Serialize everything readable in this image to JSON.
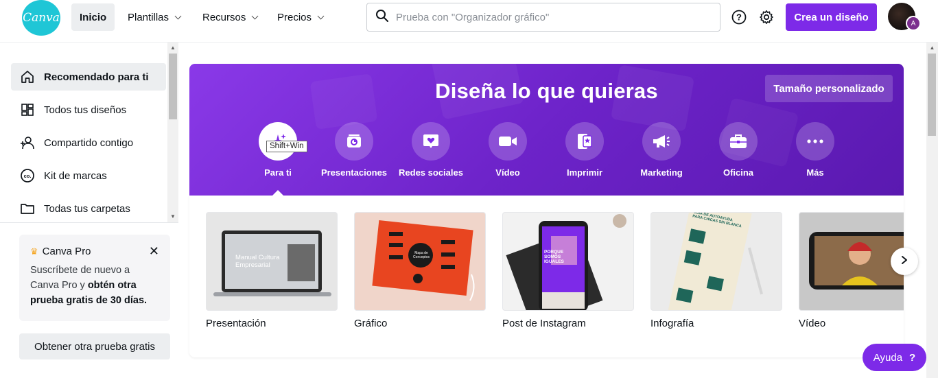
{
  "header": {
    "logo_text": "Canva",
    "nav": [
      {
        "label": "Inicio"
      },
      {
        "label": "Plantillas"
      },
      {
        "label": "Recursos"
      },
      {
        "label": "Precios"
      }
    ],
    "search_placeholder": "Prueba con \"Organizador gráfico\"",
    "create_label": "Crea un diseño",
    "avatar_initial": "A"
  },
  "sidebar": {
    "items": [
      {
        "label": "Recomendado para ti",
        "icon": "home-icon"
      },
      {
        "label": "Todos tus diseños",
        "icon": "grid-icon"
      },
      {
        "label": "Compartido contigo",
        "icon": "users-icon"
      },
      {
        "label": "Kit de marcas",
        "icon": "brand-kit-icon"
      },
      {
        "label": "Todas tus carpetas",
        "icon": "folder-icon"
      }
    ],
    "pro": {
      "title": "Canva Pro",
      "text_1": "Suscríbete de nuevo a Canva Pro y ",
      "text_bold": "obtén otra prueba gratis de 30 días.",
      "button": "Obtener otra prueba gratis"
    }
  },
  "hero": {
    "title": "Diseña lo que quieras",
    "custom_size": "Tamaño personalizado",
    "tooltip": "Shift+Win",
    "categories": [
      {
        "label": "Para ti",
        "icon": "sparkle-icon"
      },
      {
        "label": "Presentaciones",
        "icon": "presentation-icon"
      },
      {
        "label": "Redes sociales",
        "icon": "heart-icon"
      },
      {
        "label": "Vídeo",
        "icon": "video-camera-icon"
      },
      {
        "label": "Imprimir",
        "icon": "print-icon"
      },
      {
        "label": "Marketing",
        "icon": "megaphone-icon"
      },
      {
        "label": "Oficina",
        "icon": "briefcase-icon"
      },
      {
        "label": "Más",
        "icon": "more-icon"
      }
    ]
  },
  "templates": [
    {
      "label": "Presentación",
      "thumb_title": "Manual Cultura Empresarial"
    },
    {
      "label": "Gráfico",
      "thumb_title": "Mapa de Conceptos"
    },
    {
      "label": "Post de Instagram",
      "thumb_title": "PORQUE SOMOS IGUALES"
    },
    {
      "label": "Infografía",
      "thumb_title": "GUÍA DE AUTOAYUDA PARA CHICAS SIN BLANCA"
    },
    {
      "label": "Vídeo"
    }
  ],
  "help": {
    "label": "Ayuda",
    "icon": "?"
  },
  "colors": {
    "brand_purple": "#7d2ae8",
    "logo_teal": "#1fc6d6"
  }
}
